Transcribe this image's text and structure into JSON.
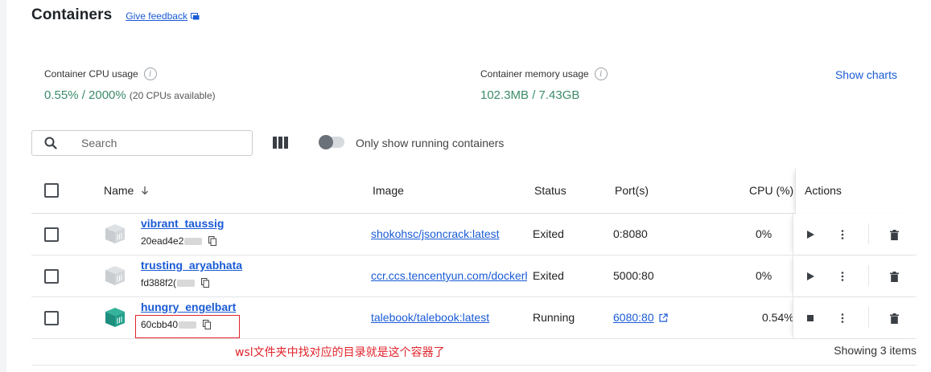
{
  "page": {
    "title": "Containers",
    "feedback_label": "Give feedback"
  },
  "stats": {
    "cpu_label": "Container CPU usage",
    "cpu_value": "0.55% / 2000%",
    "cpu_available": "(20 CPUs available)",
    "memory_label": "Container memory usage",
    "memory_value": "102.3MB / 7.43GB",
    "show_charts": "Show charts"
  },
  "toolbar": {
    "search_placeholder": "Search",
    "toggle_label": "Only show running containers",
    "toggle_on": false
  },
  "table": {
    "headers": {
      "name": "Name",
      "image": "Image",
      "status": "Status",
      "ports": "Port(s)",
      "cpu": "CPU (%)",
      "actions": "Actions"
    },
    "rows": [
      {
        "name": "vibrant_taussig",
        "id": "20ead4e2",
        "image": "shokohsc/jsoncrack:latest",
        "status": "Exited",
        "port": "0:8080",
        "port_link": false,
        "cpu": "0%",
        "running": false
      },
      {
        "name": "trusting_aryabhata",
        "id": "fd388f2(",
        "image": "ccr.ccs.tencentyun.com/dockerhub/",
        "status": "Exited",
        "port": "5000:80",
        "port_link": false,
        "cpu": "0%",
        "running": false
      },
      {
        "name": "hungry_engelbart",
        "id": "60cbb40",
        "image": "talebook/talebook:latest",
        "status": "Running",
        "port": "6080:80",
        "port_link": true,
        "cpu": "0.54%",
        "running": true
      }
    ]
  },
  "annotation": "wsl文件夹中找对应的目录就是这个容器了",
  "footer": {
    "showing": "Showing 3 items"
  },
  "colors": {
    "link": "#1a5bd6",
    "stat_value": "#3c8c6a",
    "annotation_red": "#e0242b",
    "running_icon": "#1e8f7e",
    "stopped_icon": "#c9cdd1"
  }
}
